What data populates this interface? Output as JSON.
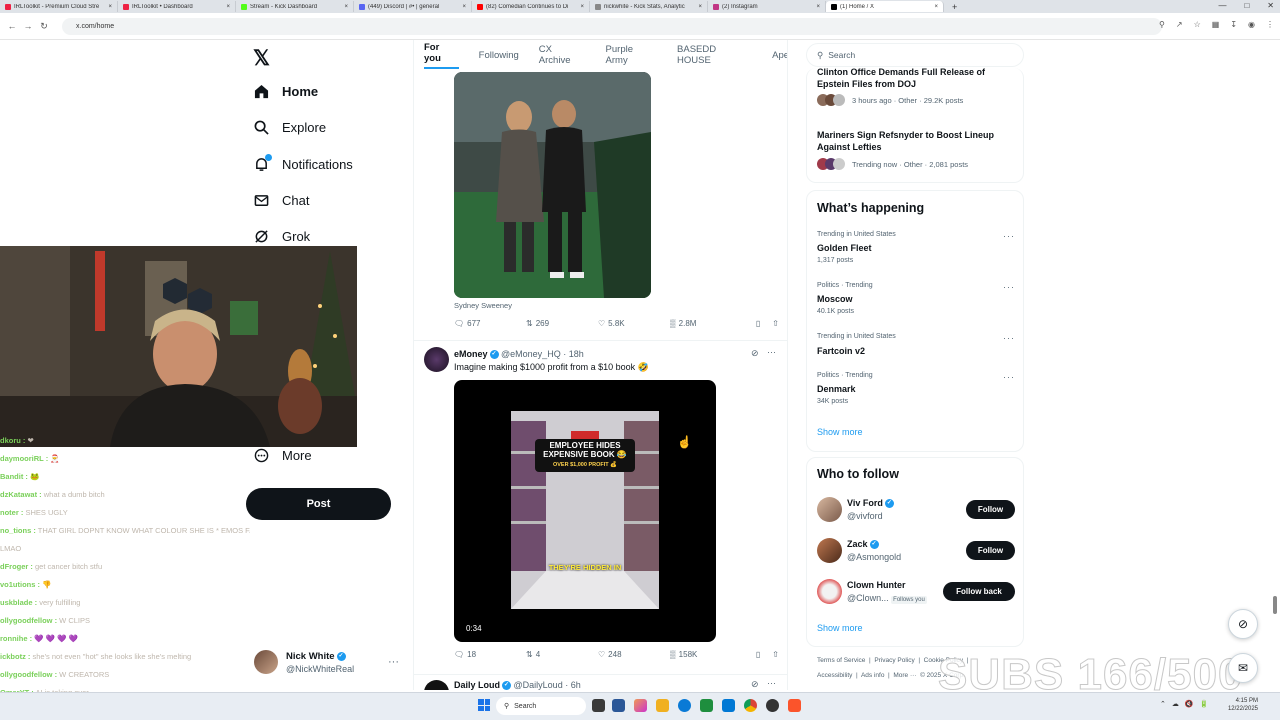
{
  "browser": {
    "tabs": [
      {
        "label": "IRLToolkit - Premium Cloud Stre",
        "color": "#e24"
      },
      {
        "label": "IRLToolkit • Dashboard",
        "color": "#e24"
      },
      {
        "label": "Stream - Kick Dashboard",
        "color": "#53fc18"
      },
      {
        "label": "(449) Discord | #• | general",
        "color": "#5865f2"
      },
      {
        "label": "(82) Comedian Continues to Di",
        "color": "#f00"
      },
      {
        "label": "nickwhite - Kick Stats, Analytic",
        "color": "#888"
      },
      {
        "label": "(2) Instagram",
        "color": "#c13584"
      },
      {
        "label": "(1) Home / X",
        "color": "#000"
      }
    ],
    "url": "x.com/home"
  },
  "x_logo": "𝕏",
  "nav": {
    "home": "Home",
    "explore": "Explore",
    "notifications": "Notifications",
    "chat": "Chat",
    "grok": "Grok",
    "more": "More",
    "post": "Post"
  },
  "account": {
    "name": "Nick White",
    "handle": "@NickWhiteReal"
  },
  "chat_lines": [
    {
      "user": "dkoru :",
      "msg": "❤"
    },
    {
      "user": "daymooriRL :",
      "msg": "🎅"
    },
    {
      "user": "Bandit :",
      "msg": "🐸"
    },
    {
      "user": "dzKatawat :",
      "msg": "what a dumb bitch"
    },
    {
      "user": "noter :",
      "msg": "SHES UGLY"
    },
    {
      "user": "no_tions :",
      "msg": "THAT GIRL DOPNT KNOW WHAT COLOUR SHE IS * EMOS FATHER"
    },
    {
      "user": "",
      "msg": "LMAO"
    },
    {
      "user": "dFroger :",
      "msg": "get cancer bitch stfu"
    },
    {
      "user": "vo1utions :",
      "msg": "👎"
    },
    {
      "user": "uskblade :",
      "msg": "very fulfilling"
    },
    {
      "user": "ollygoodfellow :",
      "msg": "W CLIPS"
    },
    {
      "user": "ronnihe :",
      "msg": "💜 💜 💜 💜"
    },
    {
      "user": "ickbotz :",
      "msg": "she's not even \"hot\" she looks like she's melting"
    },
    {
      "user": "ollygoodfellow :",
      "msg": "W CREATORS"
    },
    {
      "user": "OmarYT :",
      "msg": "AI is taking over"
    },
    {
      "user": "ollygoodfellow :",
      "msg": "W REACTIONS"
    }
  ],
  "feed": {
    "tabs": [
      "For you",
      "Following",
      "CX Archive",
      "Purple Army",
      "BASEDD HOUSE",
      "Ape"
    ],
    "post1": {
      "caption": "Sydney Sweeney",
      "replies": "677",
      "reposts": "269",
      "likes": "5.8K",
      "views": "2.8M"
    },
    "post2": {
      "name": "eMoney",
      "handle": "@eMoney_HQ · 18h",
      "text": "Imagine making $1000 profit from a $10 book 🤣",
      "video_title": "EMPLOYEE HIDES EXPENSIVE BOOK 😂",
      "video_badge": "OVER $1,000 PROFIT 💰",
      "video_subtitle": "THEY'RE HIDDEN IN",
      "duration": "0:34",
      "replies": "18",
      "reposts": "4",
      "likes": "248",
      "views": "158K"
    },
    "post3": {
      "name": "Daily Loud",
      "handle": "@DailyLoud · 6h"
    }
  },
  "right": {
    "search_placeholder": "Search",
    "news": [
      {
        "title1": "Clinton Office Demands Full Release of",
        "title2": "Epstein Files from DOJ",
        "meta": "3 hours ago · Other · 29.2K posts"
      },
      {
        "title1": "Mariners Sign Refsnyder to Boost Lineup",
        "title2": "Against Lefties",
        "meta": "Trending now · Other · 2,081 posts"
      }
    ],
    "whats_happening": "What’s happening",
    "trends": [
      {
        "ctx": "Trending in United States",
        "name": "Golden Fleet",
        "count": "1,317 posts"
      },
      {
        "ctx": "Politics · Trending",
        "name": "Moscow",
        "count": "40.1K posts"
      },
      {
        "ctx": "Trending in United States",
        "name": "Fartcoin v2",
        "count": ""
      },
      {
        "ctx": "Politics · Trending",
        "name": "Denmark",
        "count": "34K posts"
      }
    ],
    "show_more": "Show more",
    "who_to_follow": "Who to follow",
    "follow": [
      {
        "name": "Viv Ford",
        "handle": "@vivford",
        "btn": "Follow"
      },
      {
        "name": "Zack",
        "handle": "@Asmongold",
        "btn": "Follow"
      },
      {
        "name": "Clown Hunter",
        "handle": "@Clown...",
        "badge": "Follows you",
        "btn": "Follow back"
      }
    ],
    "show_more2": "Show more",
    "footer1": "Terms of Service  |  Privacy Policy  |  Cookie Policy  |",
    "footer2": "Accessibility  |  Ads info  |  More ···  © 2025 X Corp."
  },
  "overlay_subs": "SUBS 166/500",
  "taskbar": {
    "search": "Search",
    "time": "4:15 PM",
    "date": "12/22/2025"
  }
}
